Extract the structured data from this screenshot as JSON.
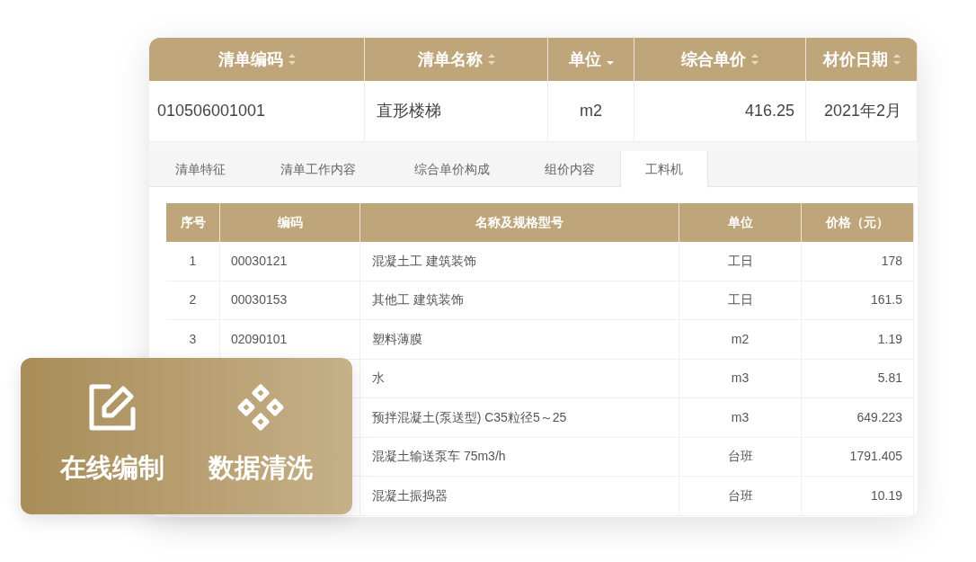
{
  "list_table": {
    "columns": [
      {
        "label": "清单编码",
        "sorted_descending": false
      },
      {
        "label": "清单名称",
        "sorted_descending": false
      },
      {
        "label": "单位",
        "sorted_descending": true
      },
      {
        "label": "综合单价",
        "sorted_descending": false
      },
      {
        "label": "材价日期",
        "sorted_descending": false
      }
    ],
    "row": [
      "010506001001",
      "直形楼梯",
      "m2",
      "416.25",
      "2021年2月"
    ]
  },
  "tabs": [
    {
      "label": "清单特征",
      "selected": false
    },
    {
      "label": "清单工作内容",
      "selected": false
    },
    {
      "label": "综合单价构成",
      "selected": false
    },
    {
      "label": "组价内容",
      "selected": false
    },
    {
      "label": "工料机",
      "selected": true
    }
  ],
  "materials_table": {
    "columns": [
      "序号",
      "编码",
      "名称及规格型号",
      "单位",
      "价格（元）"
    ],
    "rows": [
      {
        "seq": "1",
        "code": "00030121",
        "name": "混凝土工 建筑装饰",
        "unit": "工日",
        "price": "178"
      },
      {
        "seq": "2",
        "code": "00030153",
        "name": "其他工 建筑装饰",
        "unit": "工日",
        "price": "161.5"
      },
      {
        "seq": "3",
        "code": "02090101",
        "name": "塑料薄膜",
        "unit": "m2",
        "price": "1.19"
      },
      {
        "name": "水",
        "unit": "m3",
        "price": "5.81"
      },
      {
        "name": "预拌混凝土(泵送型) C35粒径5～25",
        "unit": "m3",
        "price": "649.223"
      },
      {
        "name": "混凝土输送泵车 75m3/h",
        "unit": "台班",
        "price": "1791.405"
      },
      {
        "name": "混凝土振捣器",
        "unit": "台班",
        "price": "10.19"
      }
    ]
  },
  "feature_card": {
    "items": [
      {
        "kind": "edit",
        "label": "在线编制"
      },
      {
        "kind": "clean",
        "label": "数据清洗"
      }
    ]
  }
}
